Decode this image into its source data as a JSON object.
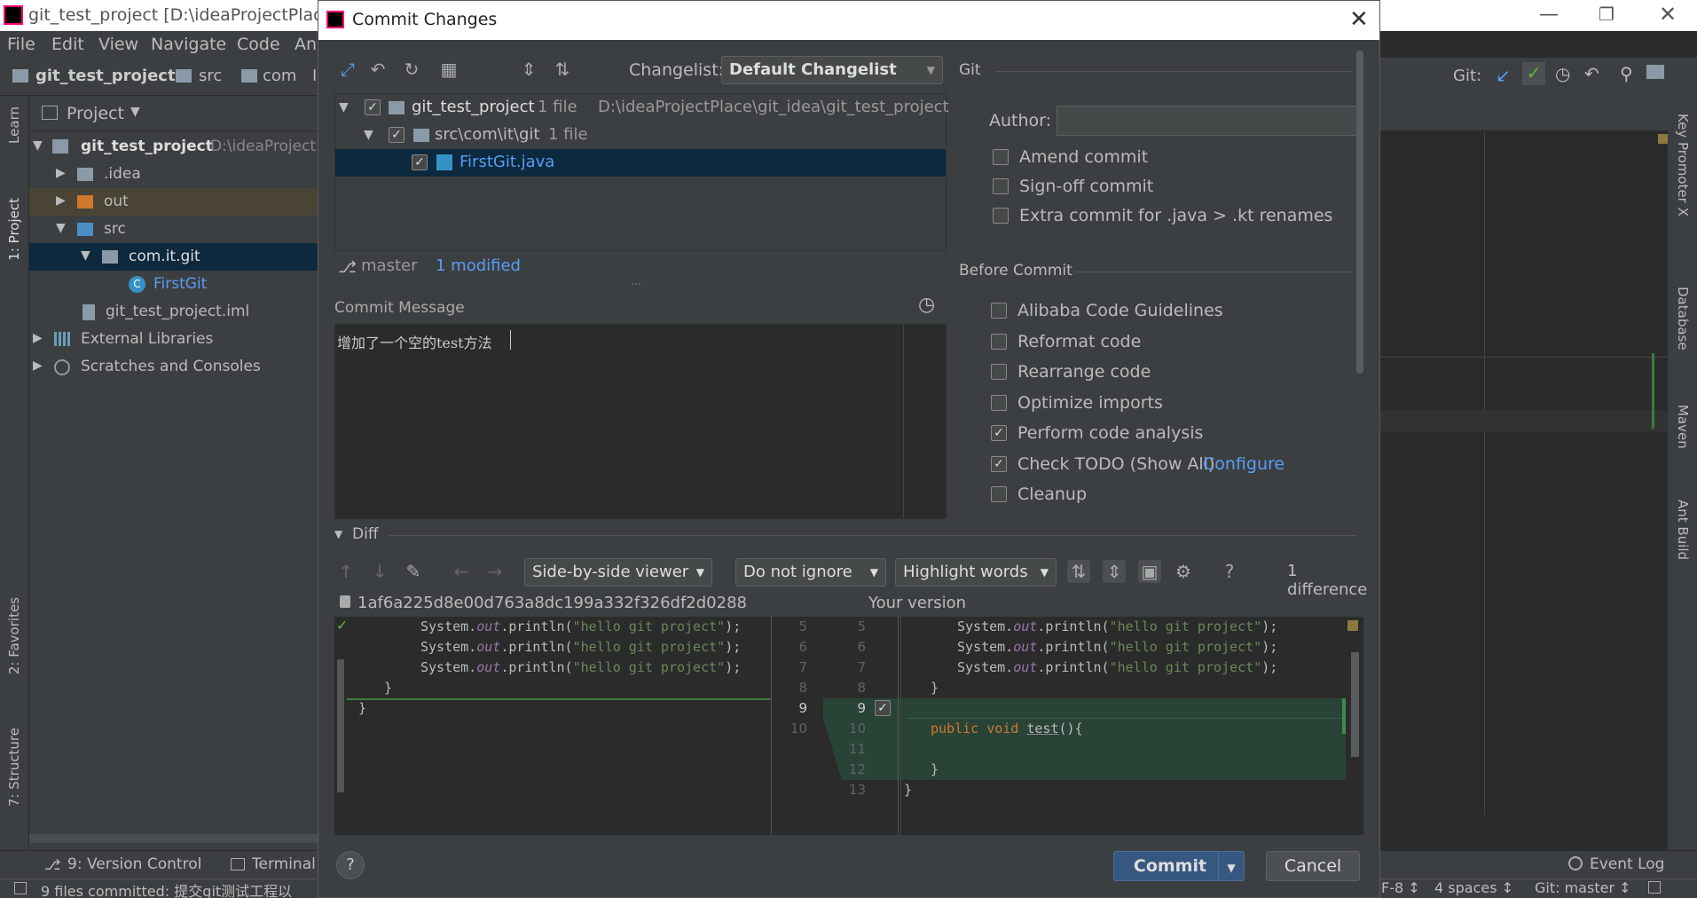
{
  "ide": {
    "title": "git_test_project [D:\\ideaProjectPlace\\g",
    "menu": [
      "File",
      "Edit",
      "View",
      "Navigate",
      "Code",
      "An"
    ],
    "breadcrumb": [
      "git_test_project",
      "src",
      "com",
      "I"
    ],
    "git_label": "Git:",
    "left_tabs": [
      "Learn",
      "1: Project",
      "2: Favorites",
      "7: Structure"
    ],
    "right_tabs": [
      "Key Promoter X",
      "Database",
      "Maven",
      "Ant Build"
    ],
    "project_header": "Project",
    "tree": [
      {
        "label": "git_test_project",
        "extra": "D:\\ideaProject"
      },
      {
        "label": ".idea"
      },
      {
        "label": "out"
      },
      {
        "label": "src"
      },
      {
        "label": "com.it.git"
      },
      {
        "label": "FirstGit"
      },
      {
        "label": "git_test_project.iml"
      },
      {
        "label": "External Libraries"
      },
      {
        "label": "Scratches and Consoles"
      }
    ],
    "bottom_tabs": [
      "9: Version Control",
      "Terminal"
    ],
    "event_log": "Event Log",
    "status_left": "9 files committed: 提交git测试工程以",
    "status_right": {
      "encoding": "F-8 ↕",
      "indent": "4 spaces ↕",
      "branch": "Git: master ↕"
    }
  },
  "dialog": {
    "title": "Commit Changes",
    "changelist_label": "Changelist:",
    "changelist_value": "Default Changelist",
    "tree": [
      {
        "label": "git_test_project",
        "count": "1 file",
        "path": "D:\\ideaProjectPlace\\git_idea\\git_test_project"
      },
      {
        "label": "src\\com\\it\\git",
        "count": "1 file"
      },
      {
        "label": "FirstGit.java"
      }
    ],
    "branch": "master",
    "modified": "1 modified",
    "commit_message_label": "Commit Message",
    "commit_message": "增加了一个空的test方法",
    "git_section": "Git",
    "author_label": "Author:",
    "author_value": "",
    "git_options": [
      {
        "label": "Amend commit",
        "checked": false
      },
      {
        "label": "Sign-off commit",
        "checked": false
      },
      {
        "label": "Extra commit for .java > .kt renames",
        "checked": false
      }
    ],
    "before_commit_section": "Before Commit",
    "before_commit": [
      {
        "label": "Alibaba Code Guidelines",
        "checked": false
      },
      {
        "label": "Reformat code",
        "checked": false
      },
      {
        "label": "Rearrange code",
        "checked": false
      },
      {
        "label": "Optimize imports",
        "checked": false
      },
      {
        "label": "Perform code analysis",
        "checked": true
      },
      {
        "label": "Check TODO (Show All)",
        "checked": true,
        "link": "Configure"
      },
      {
        "label": "Cleanup",
        "checked": false
      }
    ],
    "diff_section": "Diff",
    "viewer_mode": "Side-by-side viewer",
    "ignore_mode": "Do not ignore",
    "highlight_mode": "Highlight words",
    "difference_count": "1 difference",
    "left_revision": "1af6a225d8e00d763a8dc199a332f326df2d0288",
    "right_revision": "Your version",
    "left_lines": [
      {
        "num": "5"
      },
      {
        "num": "6"
      },
      {
        "num": "7"
      },
      {
        "num": "8"
      },
      {
        "num": "9"
      },
      {
        "num": "10"
      }
    ],
    "right_lines": [
      {
        "num": "5"
      },
      {
        "num": "6"
      },
      {
        "num": "7"
      },
      {
        "num": "8"
      },
      {
        "num": "9"
      },
      {
        "num": "10"
      },
      {
        "num": "11"
      },
      {
        "num": "12"
      },
      {
        "num": "13"
      }
    ],
    "code": {
      "println_prefix": "System.",
      "println_out": "out",
      "println_call": ".println(",
      "println_str": "\"hello git project\"",
      "println_end": ");",
      "close_brace": "}",
      "kw_public": "public",
      "kw_void": "void",
      "method": "test",
      "method_tail": "(){"
    },
    "commit_button": "Commit",
    "cancel_button": "Cancel",
    "help": "?"
  },
  "colors": {
    "added_bg": "#294436",
    "selected_bg": "#0d293e",
    "link": "#589df6",
    "accent_btn": "#365880"
  }
}
